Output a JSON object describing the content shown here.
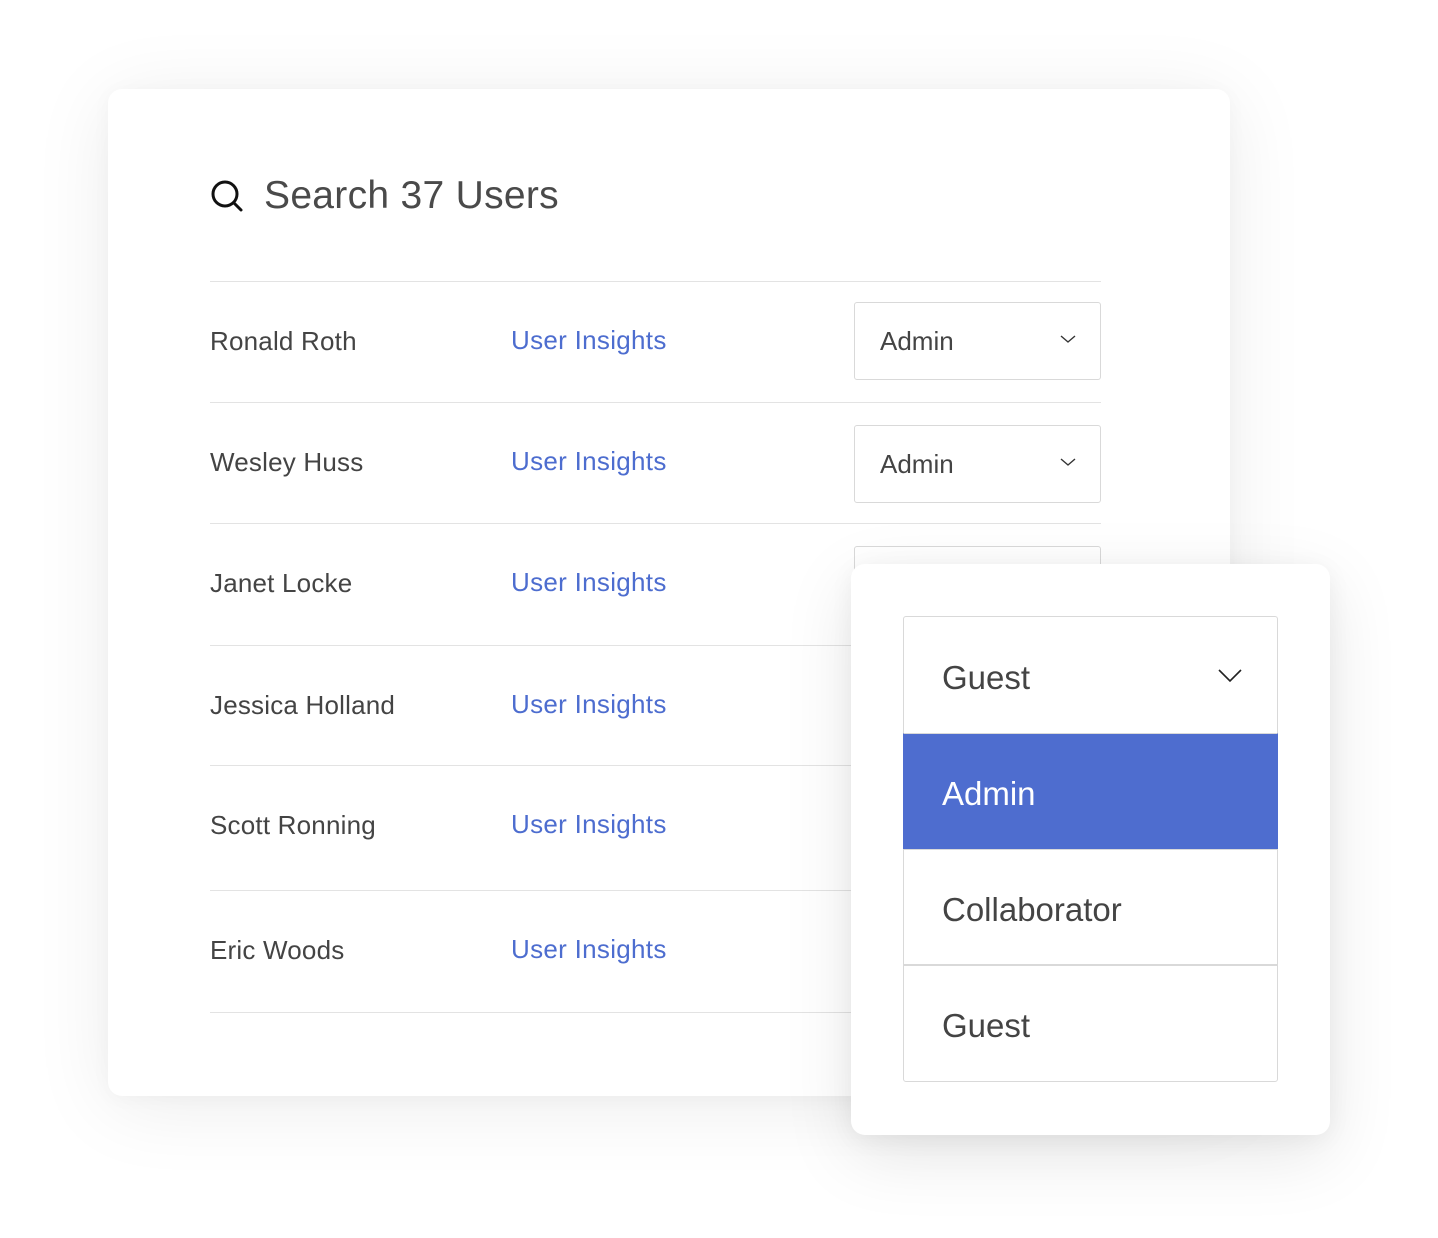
{
  "search": {
    "icon": "search-icon",
    "label": "Search 37 Users"
  },
  "users": [
    {
      "name": "Ronald Roth",
      "link": "User Insights",
      "role": "Admin"
    },
    {
      "name": "Wesley Huss",
      "link": "User Insights",
      "role": "Admin"
    },
    {
      "name": "Janet Locke",
      "link": "User Insights",
      "role": ""
    },
    {
      "name": "Jessica Holland",
      "link": "User Insights",
      "role": ""
    },
    {
      "name": "Scott Ronning",
      "link": "User Insights",
      "role": ""
    },
    {
      "name": "Eric Woods",
      "link": "User Insights",
      "role": ""
    }
  ],
  "role_dropdown": {
    "current": "Guest",
    "chevron_icon": "chevron-down-icon",
    "options": [
      {
        "label": "Admin",
        "selected": true
      },
      {
        "label": "Collaborator",
        "selected": false
      },
      {
        "label": "Guest",
        "selected": false
      }
    ]
  },
  "colors": {
    "accent": "#4e6dcf",
    "link": "#4d6dcf",
    "text": "#444444",
    "border": "#d9d9d9"
  }
}
